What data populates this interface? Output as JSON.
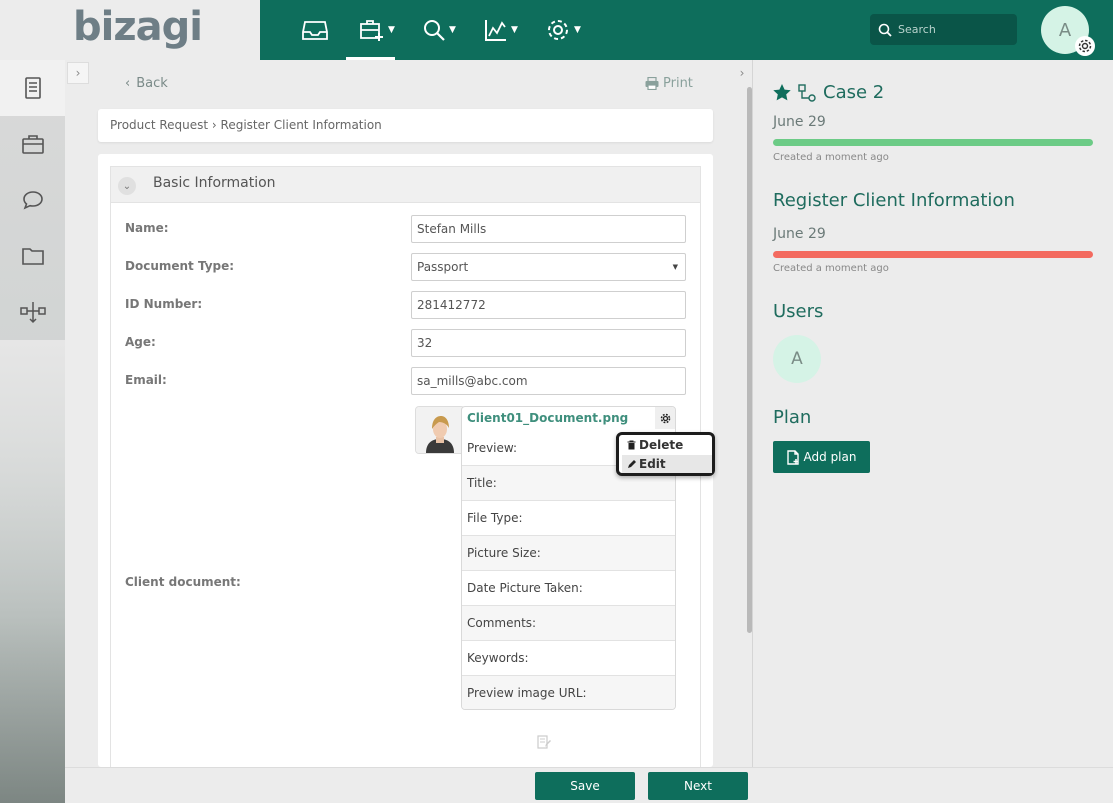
{
  "app": {
    "logo": "bizagi"
  },
  "topnav": {
    "items": [
      {
        "icon": "inbox-icon",
        "has_caret": false
      },
      {
        "icon": "new-case-icon",
        "has_caret": true
      },
      {
        "icon": "search-icon",
        "has_caret": true
      },
      {
        "icon": "analytics-icon",
        "has_caret": true
      },
      {
        "icon": "settings-icon",
        "has_caret": true
      }
    ],
    "search_placeholder": "Search",
    "user_initial": "A"
  },
  "page": {
    "back_label": "Back",
    "print_label": "Print",
    "breadcrumb": "Product Request › Register Client Information"
  },
  "form": {
    "section_title": "Basic Information",
    "fields": {
      "name": {
        "label": "Name:",
        "value": "Stefan Mills"
      },
      "document_type": {
        "label": "Document Type:",
        "value": "Passport"
      },
      "id_number": {
        "label": "ID Number:",
        "value": "281412772"
      },
      "age": {
        "label": "Age:",
        "value": "32"
      },
      "email": {
        "label": "Email:",
        "value": "sa_mills@abc.com"
      },
      "client_document": {
        "label": "Client document:"
      }
    },
    "file": {
      "name": "Client01_Document.png",
      "properties": [
        "Preview:",
        "Title:",
        "File Type:",
        "Picture Size:",
        "Date Picture Taken:",
        "Comments:",
        "Keywords:",
        "Preview image URL:"
      ],
      "menu": {
        "delete": "Delete",
        "edit": "Edit"
      }
    }
  },
  "footer": {
    "save": "Save",
    "next": "Next"
  },
  "panel": {
    "case_title": "Case 2",
    "case_date": "June 29",
    "case_created": "Created a moment ago",
    "task_title": "Register Client Information",
    "task_date": "June 29",
    "task_created": "Created a moment ago",
    "users_heading": "Users",
    "user_initial": "A",
    "plan_heading": "Plan",
    "add_plan": "Add plan"
  },
  "colors": {
    "brand": "#0e6e5c",
    "case_bar": "#6ccb86",
    "task_bar": "#f36a5f"
  }
}
